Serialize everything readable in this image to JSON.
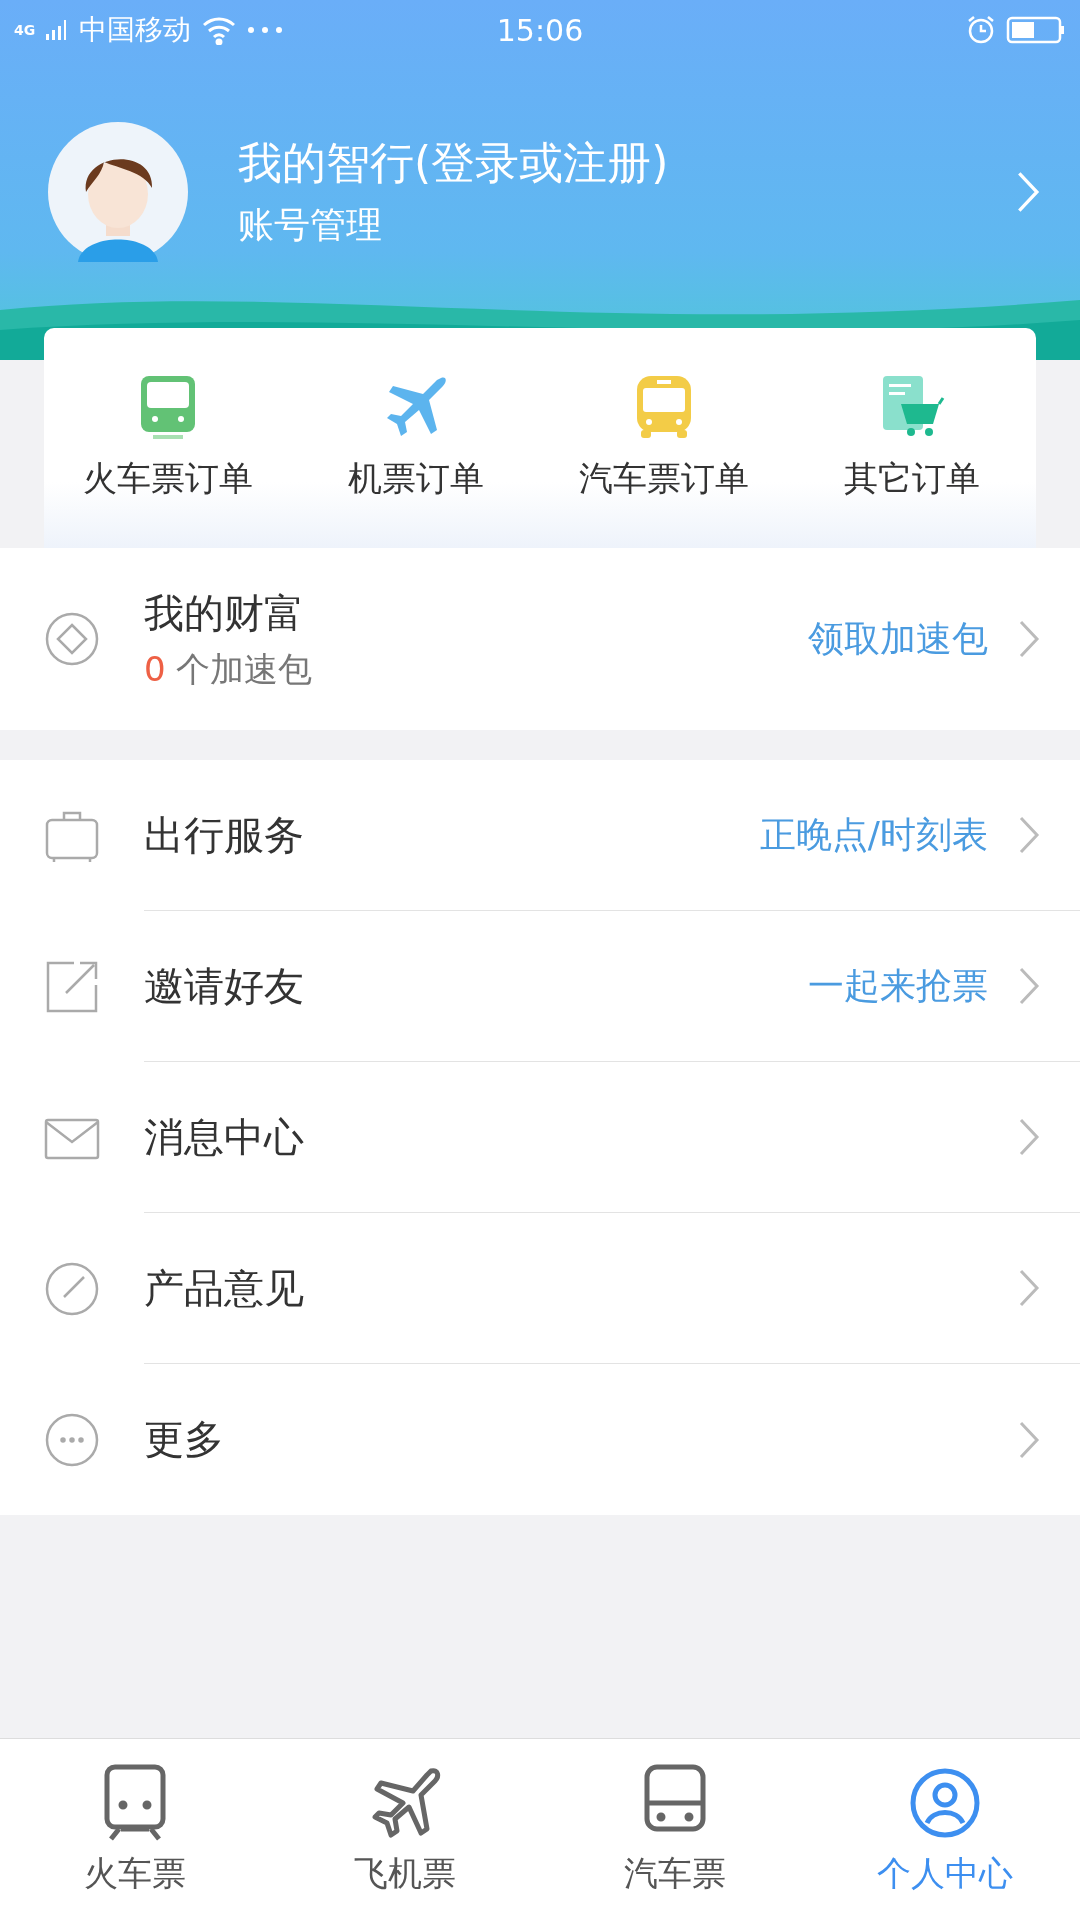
{
  "status_bar": {
    "network": "4G",
    "carrier": "中国移动",
    "time": "15:06"
  },
  "profile": {
    "title": "我的智行(登录或注册)",
    "subtitle": "账号管理"
  },
  "orders": [
    {
      "kind": "train",
      "label": "火车票订单"
    },
    {
      "kind": "plane",
      "label": "机票订单"
    },
    {
      "kind": "bus",
      "label": "汽车票订单"
    },
    {
      "kind": "cart",
      "label": "其它订单"
    }
  ],
  "wealth": {
    "title": "我的财富",
    "count": "0",
    "count_suffix": "个加速包",
    "action": "领取加速包"
  },
  "menu": [
    {
      "kind": "suitcase",
      "label": "出行服务",
      "action": "正晚点/时刻表"
    },
    {
      "kind": "share",
      "label": "邀请好友",
      "action": "一起来抢票"
    },
    {
      "kind": "mail",
      "label": "消息中心"
    },
    {
      "kind": "pen",
      "label": "产品意见"
    },
    {
      "kind": "more",
      "label": "更多"
    }
  ],
  "tabs": [
    {
      "kind": "train",
      "label": "火车票",
      "selected": false
    },
    {
      "kind": "plane",
      "label": "飞机票",
      "selected": false
    },
    {
      "kind": "bus",
      "label": "汽车票",
      "selected": false
    },
    {
      "kind": "person",
      "label": "个人中心",
      "selected": true
    }
  ]
}
